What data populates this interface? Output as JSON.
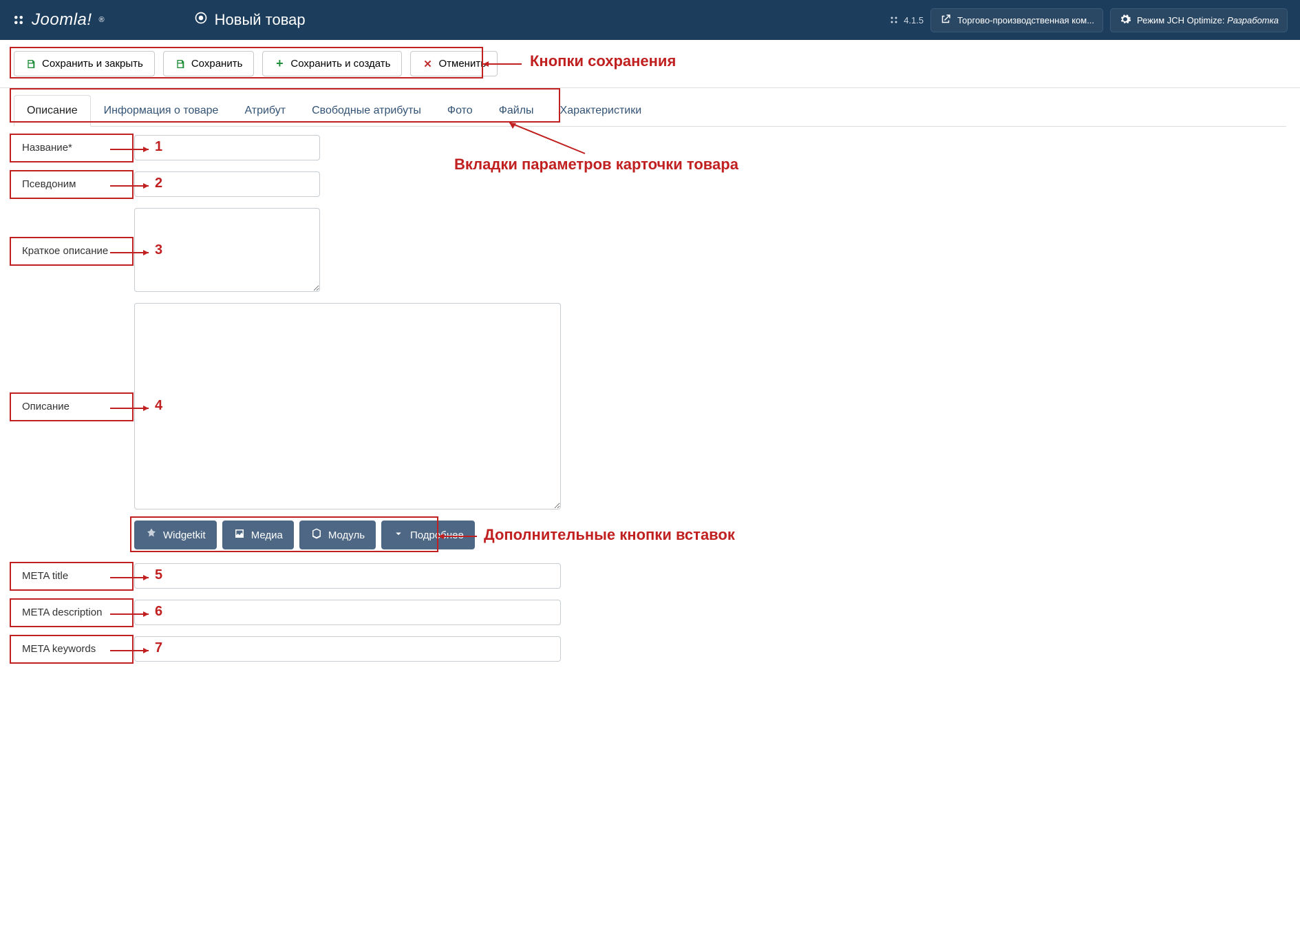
{
  "header": {
    "brand_text": "Joomla!",
    "page_title": "Новый товар",
    "version": "4.1.5",
    "site_btn": "Торгово-производственная ком...",
    "mode_btn_prefix": "Режим JCH Optimize: ",
    "mode_btn_value": "Разработка"
  },
  "toolbar": {
    "save_close": "Сохранить и закрыть",
    "save": "Сохранить",
    "save_new": "Сохранить и создать",
    "cancel": "Отменить"
  },
  "tabs": {
    "desc": "Описание",
    "info": "Информация о товаре",
    "attr": "Атрибут",
    "free_attr": "Свободные атрибуты",
    "photo": "Фото",
    "files": "Файлы",
    "chars": "Характеристики"
  },
  "fields": {
    "name": "Название*",
    "alias": "Псевдоним",
    "short_desc": "Краткое описание",
    "desc": "Описание",
    "meta_title": "META title",
    "meta_desc": "META description",
    "meta_keywords": "META keywords"
  },
  "insert_buttons": {
    "widgetkit": "Widgetkit",
    "media": "Медиа",
    "module": "Модуль",
    "more": "Подробнее"
  },
  "annotations": {
    "save_label": "Кнопки сохранения",
    "tabs_label": "Вкладки параметров карточки товара",
    "insert_label": "Дополнительные кнопки вставок",
    "n1": "1",
    "n2": "2",
    "n3": "3",
    "n4": "4",
    "n5": "5",
    "n6": "6",
    "n7": "7"
  }
}
